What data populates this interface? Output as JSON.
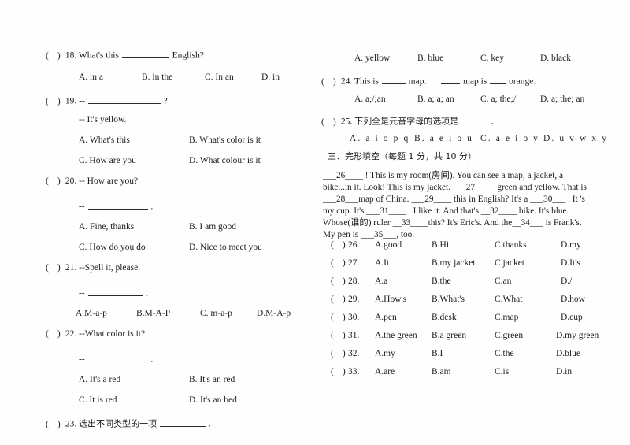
{
  "document": {
    "type": "english-exam-worksheet",
    "page_background": "#ffffff",
    "text_color": "#1c1c1c"
  },
  "left_column": {
    "questions": [
      {
        "marker": "18.",
        "stem_before": "What's this",
        "stem_after": "English?",
        "options": [
          "A. in a",
          "B. in the",
          "C. In an",
          "D. in"
        ]
      },
      {
        "marker": "19.",
        "stem_before": "--",
        "stem_after": "?",
        "reply": "-- It's yellow.",
        "options": [
          "A. What's this",
          "B. What's color is it",
          "C. How are you",
          "D. What colour is it"
        ]
      },
      {
        "marker": "20.",
        "stem": "-- How are you?",
        "reply_before": "--",
        "reply_after": ".",
        "options": [
          "A. Fine, thanks",
          "B. I am good",
          "C. How do you do",
          "D. Nice to meet you"
        ]
      },
      {
        "marker": "21.",
        "stem": "--Spell it, please.",
        "reply_before": "--",
        "reply_after": ".",
        "options": [
          "A.M-a-p",
          "B.M-A-P",
          "C. m-a-p",
          "D.M-A-p"
        ]
      },
      {
        "marker": "22.",
        "stem": "--What color is it?",
        "reply_before": "--",
        "reply_after": ".",
        "options": [
          "A. It's a red",
          "B. It's an red",
          "C. It is red",
          "D. It's an bed"
        ]
      },
      {
        "marker": "23.",
        "stem_before": "选出不同类型的一项",
        "stem_after": "."
      }
    ]
  },
  "right_column": {
    "question_23_options": [
      "A. yellow",
      "B. blue",
      "C. key",
      "D. black"
    ],
    "questions": [
      {
        "marker": "24.",
        "stem_part1": "This is",
        "stem_part2": "map.",
        "stem_part3": "map is",
        "stem_part4": "orange.",
        "options": [
          "A. a;/;an",
          "B. a; a; an",
          "C. a; the;/",
          "D. a; the; an"
        ]
      },
      {
        "marker": "25.",
        "stem_before": "下列全是元音字母的选项是",
        "stem_after": ".",
        "options": [
          "A. a i o p q",
          "B. a e i o u",
          "C. a e i o v",
          "D. u v w x y"
        ]
      }
    ],
    "section_heading": "三．完形填空（每题 1 分，共 10 分）",
    "passage_lines": [
      "___26____ ! This is my room(房间). You can see a map, a jacket, a",
      "bike...in it. Look! This is my jacket. ___27_____green and yellow. That is",
      "___28___map of China. ___29____ this in English? It's a ___30___ . It 's",
      "my cup. It's ___31____ . I like it. And that's __32____ bike. It's blue.",
      "Whose(谁的) ruler __33____this? It's Eric's. And the__34___ is Frank's.",
      "My pen is ___35___, too."
    ],
    "cloze_items": [
      {
        "marker": "26.",
        "options": [
          "A.good",
          "B.Hi",
          "C.thanks",
          "D.my"
        ]
      },
      {
        "marker": "27.",
        "options": [
          "A.It",
          "B.my jacket",
          "C.jacket",
          "D.It's"
        ]
      },
      {
        "marker": "28.",
        "options": [
          "A.a",
          "B.the",
          "C.an",
          "D./"
        ]
      },
      {
        "marker": "29.",
        "options": [
          "A.How's",
          "B.What's",
          "C.What",
          "D.how"
        ]
      },
      {
        "marker": "30.",
        "options": [
          "A.pen",
          "B.desk",
          "C.map",
          "D.cup"
        ]
      },
      {
        "marker": "31.",
        "options": [
          "A.the green",
          "B.a green",
          "C.green",
          "D.my green"
        ]
      },
      {
        "marker": "32.",
        "options": [
          "A.my",
          "B.I",
          "C.the",
          "D.blue"
        ]
      },
      {
        "marker": "33.",
        "options": [
          "A.are",
          "B.am",
          "C.is",
          "D.in"
        ]
      }
    ]
  }
}
